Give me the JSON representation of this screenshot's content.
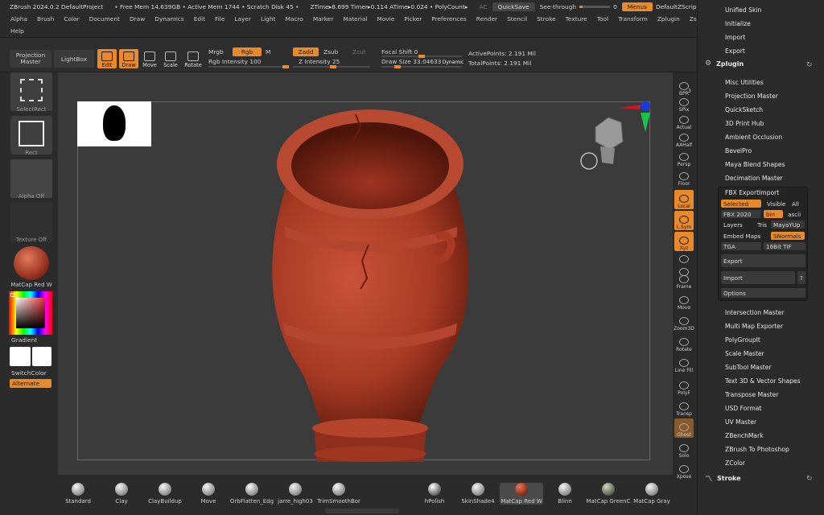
{
  "titlebar": {
    "title": "ZBrush 2024.0.2 DefaultProject",
    "free_mem": "• Free Mem 14.639GB • Active Mem 1744 • Scratch Disk 45 •",
    "ztime": "ZTime▸8.699 Timer▸0.114 ATime▸0.024 • PolyCount▸",
    "ac": "AC",
    "quicksave": "QuickSave",
    "see_through": "See-through",
    "see_through_value": "0",
    "menus": "Menus",
    "default_zscript": "DefaultZScript"
  },
  "menubar": {
    "row1": [
      "Alpha",
      "Brush",
      "Color",
      "Document",
      "Draw",
      "Dynamics",
      "Edit",
      "File",
      "Layer",
      "Light",
      "Macro",
      "Marker",
      "Material",
      "Movie",
      "Picker",
      "Preferences",
      "Render",
      "Stencil",
      "Stroke",
      "Texture",
      "Tool",
      "Transform",
      "Zplugin",
      "Zscript"
    ],
    "row2": [
      "Help"
    ]
  },
  "toolbar": {
    "projection_master": "Projection Master",
    "lightbox": "LightBox",
    "edit": "Edit",
    "draw": "Draw",
    "move": "Move",
    "scale": "Scale",
    "rotate": "Rotate",
    "mrgb": "Mrgb",
    "rgb": "Rgb",
    "m": "M",
    "rgb_intensity_label": "Rgb Intensity",
    "rgb_intensity_value": "100",
    "zadd": "Zadd",
    "zsub": "Zsub",
    "zcut": "Zcut",
    "z_intensity_label": "Z Intensity",
    "z_intensity_value": "25",
    "focal_shift_label": "Focal Shift",
    "focal_shift_value": "0",
    "draw_size_label": "Draw Size",
    "draw_size_value": "33.04633",
    "dynamic": "Dynamic",
    "active_points": "ActivePoints: 2.191 Mil",
    "total_points": "TotalPoints: 2.191 Mil"
  },
  "leftpanel": {
    "select_rect": "SelectRect",
    "rect": "Rect",
    "alpha_off": "Alpha Off",
    "texture_off": "Texture Off",
    "matcap": "MatCap Red W",
    "gradient": "Gradient",
    "switch_color": "SwitchColor",
    "alternate": "Alternate"
  },
  "rightshelf": [
    "BPR",
    "SPix",
    "Actual",
    "AAHalf",
    "Persp",
    "Floor",
    "Local",
    "L.Sym",
    "Xyz",
    "",
    "",
    "Frame",
    "Move",
    "Zoom3D",
    "Rotate",
    "Line Fill",
    "PolyF",
    "Transp",
    "Ghost",
    "Solo",
    "Xpose"
  ],
  "rightshelf_spix_value": "3",
  "rightpanel": {
    "top_items": [
      "Unified Skin",
      "Initialize",
      "Import",
      "Export"
    ],
    "zplugin_header": "Zplugin",
    "zplugin_items": [
      "Misc Utilities",
      "Projection Master",
      "QuickSketch",
      "3D Print Hub",
      "Ambient Occlusion",
      "BevelPro",
      "Maya Blend Shapes",
      "Decimation Master"
    ],
    "fbx": {
      "title": "FBX ExportImport",
      "selected": "Selected",
      "visible": "Visible",
      "all": "All",
      "fbx2020": "FBX 2020",
      "bin": "bin",
      "ascii": "ascii",
      "layers": "Layers",
      "tris": "Tris",
      "mayayup": "MayaYUp",
      "embed_maps": "Embed Maps",
      "snormals": "SNormals",
      "tga": "TGA",
      "tif": "16Bit TIF",
      "export": "Export",
      "import": "Import",
      "q": "?",
      "options": "Options"
    },
    "more_items": [
      "Intersection Master",
      "Multi Map Exporter",
      "PolyGroupIt",
      "Scale Master",
      "SubTool Master",
      "Text 3D & Vector Shapes",
      "Transpose Master",
      "USD Format",
      "UV Master",
      "ZBenchMark",
      "ZBrush To Photoshop",
      "ZColor"
    ],
    "stroke_header": "Stroke"
  },
  "brushes": [
    "Standard",
    "Clay",
    "ClayBuildup",
    "Move",
    "OrbFlatten_Edg",
    "jarre_high03",
    "TrimSmoothBor"
  ],
  "materials": [
    "hPolish",
    "SkinShade4",
    "MatCap Red W",
    "Blinn",
    "MatCap GreenC",
    "MatCap Gray"
  ],
  "colors": {
    "accent": "#e8892a",
    "vase": "#b9432b",
    "bg": "#2b2b2b"
  }
}
